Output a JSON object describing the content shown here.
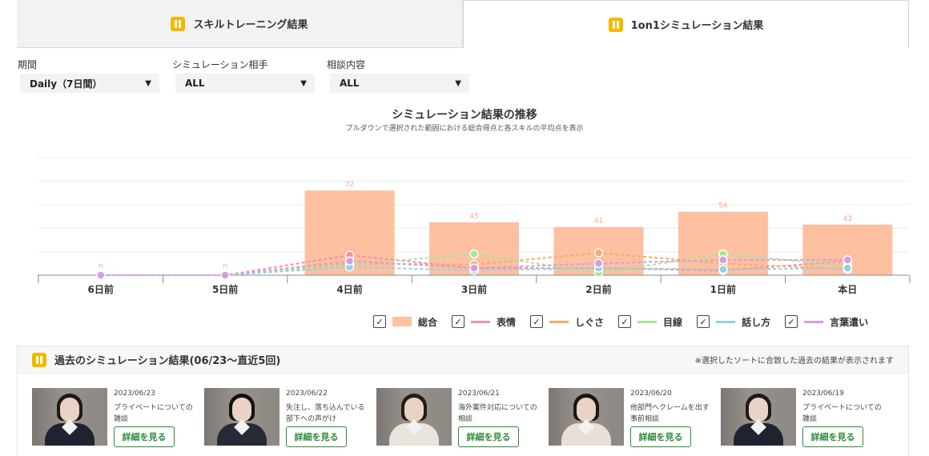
{
  "tabs": [
    {
      "label": "スキルトレーニング結果",
      "active": false
    },
    {
      "label": "1on1シミュレーション結果",
      "active": true
    }
  ],
  "filters": [
    {
      "label": "期間",
      "value": "Daily（7日間）"
    },
    {
      "label": "シミュレーション相手",
      "value": "ALL"
    },
    {
      "label": "相談内容",
      "value": "ALL"
    }
  ],
  "chart_header": {
    "title": "シミュレーション結果の推移",
    "subtitle": "プルダウンで選択された範囲における総合得点と各スキルの平均点を表示"
  },
  "chart_data": {
    "type": "bar",
    "categories": [
      "6日前",
      "5日前",
      "4日前",
      "3日前",
      "2日前",
      "1日前",
      "本日"
    ],
    "ylim": [
      0,
      100
    ],
    "grid": true,
    "legend_position": "bottom-right",
    "bar_series": {
      "name": "総合",
      "values": [
        0,
        0,
        72,
        45,
        41,
        54,
        43
      ],
      "labels": [
        "n",
        "n",
        "72",
        "45",
        "41",
        "54",
        "43"
      ],
      "color": "#fdc0a0"
    },
    "line_series": [
      {
        "name": "表情",
        "color": "#f48fa8",
        "values": [
          0,
          0,
          17,
          6,
          6,
          4,
          12
        ]
      },
      {
        "name": "しぐさ",
        "color": "#f9a96b",
        "values": [
          0,
          0,
          10,
          9,
          19,
          10,
          5
        ]
      },
      {
        "name": "目線",
        "color": "#a5e69a",
        "values": [
          0,
          0,
          9,
          18,
          2,
          18,
          8
        ]
      },
      {
        "name": "話し方",
        "color": "#8fd3e3",
        "values": [
          0,
          0,
          7,
          4,
          6,
          5,
          6
        ]
      },
      {
        "name": "言葉遣い",
        "color": "#d59ce3",
        "values": [
          0,
          0,
          12,
          6,
          10,
          13,
          13
        ]
      }
    ]
  },
  "legend": [
    {
      "label": "総合",
      "kind": "box",
      "color": "#fdc0a0"
    },
    {
      "label": "表情",
      "kind": "line",
      "color": "#f48fa8"
    },
    {
      "label": "しぐさ",
      "kind": "line",
      "color": "#f9a96b"
    },
    {
      "label": "目線",
      "kind": "line",
      "color": "#a5e69a"
    },
    {
      "label": "話し方",
      "kind": "line",
      "color": "#8fd3e3"
    },
    {
      "label": "言葉遣い",
      "kind": "line",
      "color": "#d59ce3"
    }
  ],
  "checkbox_mark": "✓",
  "caret": "▼",
  "past": {
    "title": "過去のシミュレーション結果(06/23〜直近5回)",
    "note": "※選択したソートに合致した過去の結果が表示されます",
    "button_label": "詳細を見る",
    "items": [
      {
        "date": "2023/06/23",
        "text": "プライベートについての雑談"
      },
      {
        "date": "2023/06/22",
        "text": "失注し、落ち込んでいる部下への声がけ"
      },
      {
        "date": "2023/06/21",
        "text": "海外案件対応についての相談"
      },
      {
        "date": "2023/06/20",
        "text": "他部門へクレームを出す事前相談"
      },
      {
        "date": "2023/06/19",
        "text": "プライベートについての雑談"
      }
    ]
  },
  "colors": {
    "accent_icon": "#f5b800",
    "button_green": "#2e8b3a"
  }
}
